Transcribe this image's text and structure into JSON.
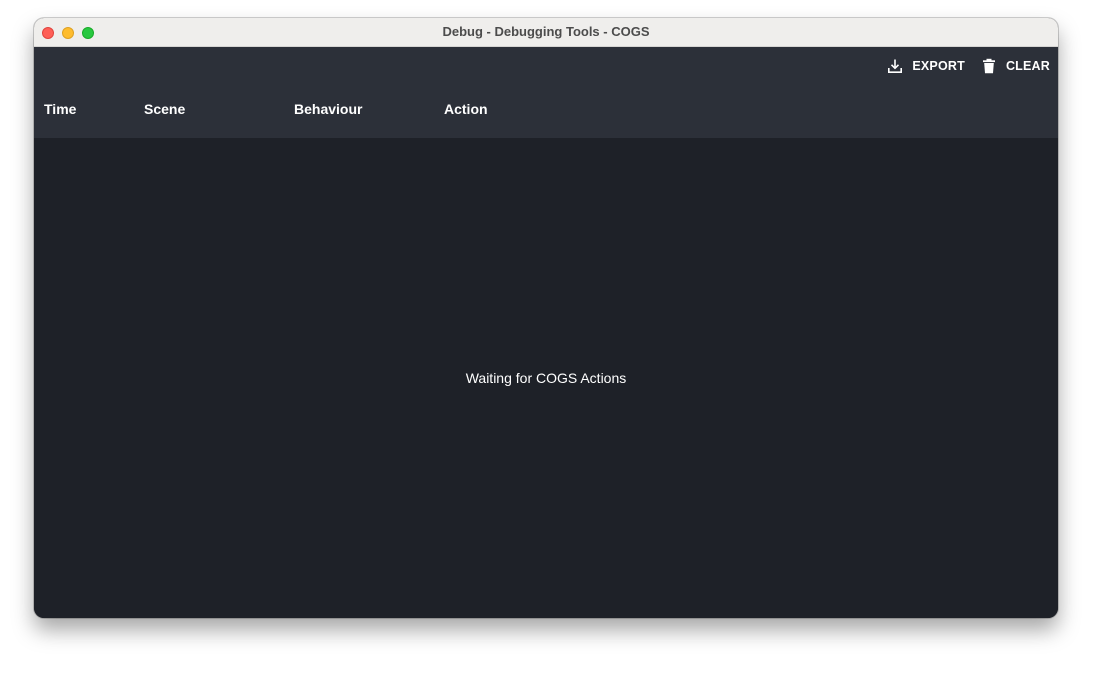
{
  "window": {
    "title": "Debug - Debugging Tools - COGS"
  },
  "toolbar": {
    "export_label": "EXPORT",
    "clear_label": "CLEAR"
  },
  "table": {
    "columns": [
      "Time",
      "Scene",
      "Behaviour",
      "Action"
    ],
    "rows": []
  },
  "content": {
    "empty_message": "Waiting for COGS Actions"
  },
  "icons": {
    "export": "download-icon",
    "clear": "trash-icon"
  },
  "colors": {
    "header_bg": "#2c3039",
    "content_bg": "#1e2128",
    "titlebar_bg": "#efeeec",
    "text": "#ffffff"
  }
}
